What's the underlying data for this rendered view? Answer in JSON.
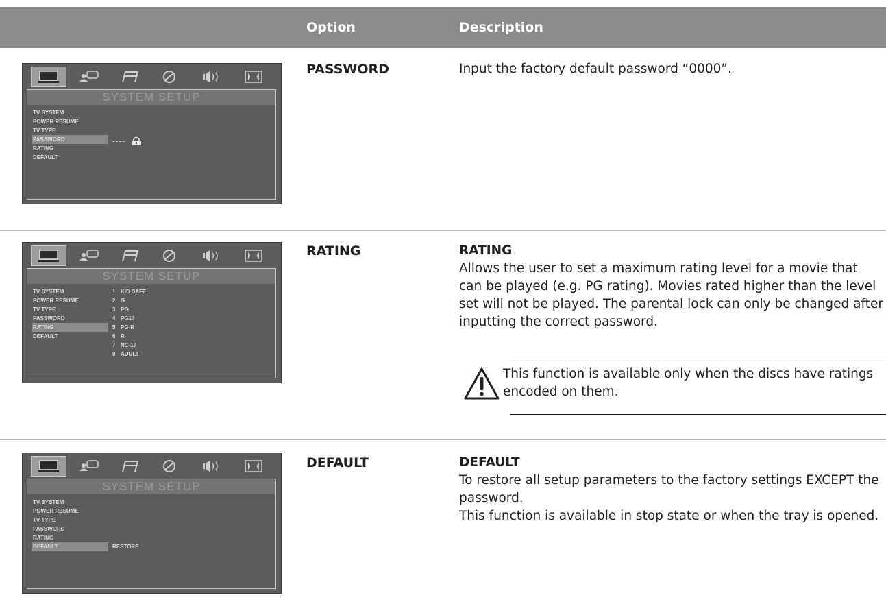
{
  "header": {
    "col_option": "Option",
    "col_description": "Description"
  },
  "colors": {
    "header_bg": "#8b8b8d",
    "osd_bg": "#5c5c5e",
    "osd_selected": "#8c8c8e"
  },
  "osd_common": {
    "title": "SYSTEM SETUP",
    "tabs": [
      "monitor-icon",
      "speaker-person-icon",
      "music-note-icon",
      "disc-icon",
      "volume-icon",
      "dolby-icon"
    ],
    "menu_items": [
      "TV SYSTEM",
      "POWER RESUME",
      "TV TYPE",
      "PASSWORD",
      "RATING",
      "DEFAULT"
    ]
  },
  "rows": [
    {
      "option": "PASSWORD",
      "description": "Input the factory default password “0000”.",
      "osd": {
        "selected_index": 3,
        "password_mask": "----",
        "lock_icon": "lock-icon"
      }
    },
    {
      "option": "RATING",
      "description_title": "RATING",
      "description": "Allows the user to set a maximum rating level for a movie that can be played (e.g. PG rating). Movies rated higher than the level set will not be played. The parental lock can only be changed after inputting the correct password.",
      "note": "This function is available only when the discs have ratings encoded on them.",
      "osd": {
        "selected_index": 4,
        "levels": [
          {
            "num": "1",
            "label": "KID SAFE"
          },
          {
            "num": "2",
            "label": "G"
          },
          {
            "num": "3",
            "label": "PG"
          },
          {
            "num": "4",
            "label": "PG13"
          },
          {
            "num": "5",
            "label": "PG-R"
          },
          {
            "num": "6",
            "label": "R"
          },
          {
            "num": "7",
            "label": "NC-17"
          },
          {
            "num": "8",
            "label": "ADULT"
          }
        ]
      }
    },
    {
      "option": "DEFAULT",
      "description_title": "DEFAULT",
      "description_line1": "To restore all setup parameters to the factory settings EXCEPT the password.",
      "description_line2": "This function is available in stop state or when the tray is opened.",
      "osd": {
        "selected_index": 5,
        "value": "RESTORE"
      }
    }
  ]
}
